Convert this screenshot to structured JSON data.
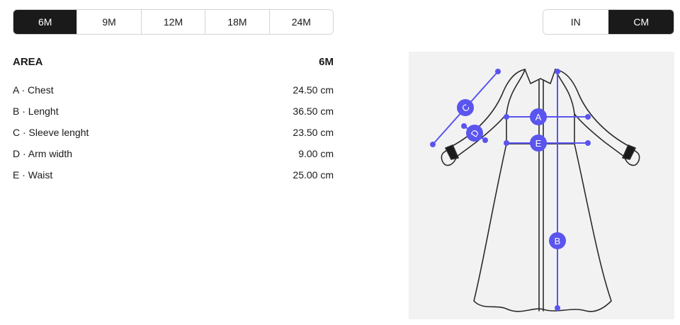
{
  "size_tabs": [
    {
      "label": "6M",
      "active": true
    },
    {
      "label": "9M",
      "active": false
    },
    {
      "label": "12M",
      "active": false
    },
    {
      "label": "18M",
      "active": false
    },
    {
      "label": "24M",
      "active": false
    }
  ],
  "unit_tabs": [
    {
      "label": "IN",
      "active": false
    },
    {
      "label": "CM",
      "active": true
    }
  ],
  "table": {
    "header_area": "AREA",
    "header_size": "6M",
    "rows": [
      {
        "label": "A · Chest",
        "value": "24.50 cm"
      },
      {
        "label": "B · Lenght",
        "value": "36.50 cm"
      },
      {
        "label": "C · Sleeve lenght",
        "value": "23.50 cm"
      },
      {
        "label": "D · Arm width",
        "value": "9.00 cm"
      },
      {
        "label": "E · Waist",
        "value": "25.00 cm"
      }
    ]
  },
  "diagram": {
    "markers": {
      "a": "A",
      "b": "B",
      "c": "C",
      "d": "D",
      "e": "E"
    },
    "colors": {
      "measure": "#5a55ee",
      "outline": "#2b2b2b",
      "panel": "#f2f2f2"
    }
  }
}
